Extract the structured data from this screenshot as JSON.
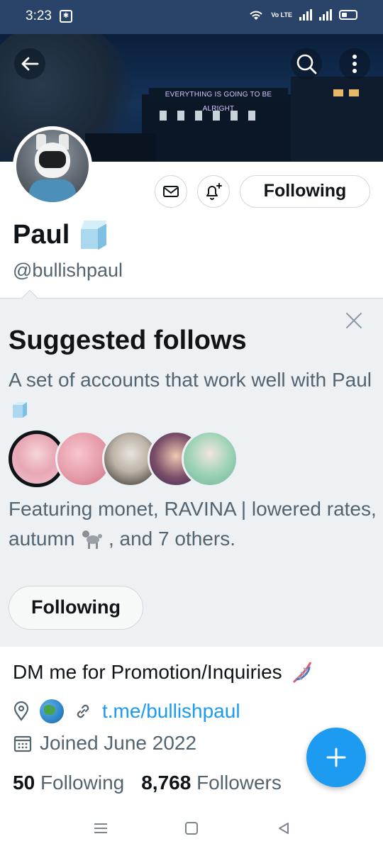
{
  "status_bar": {
    "time": "3:23",
    "network_label": "Vo LTE",
    "colors": {
      "background": "#2a4368"
    }
  },
  "banner": {
    "neon_text": "EVERYTHING IS GOING TO BE ALRIGHT",
    "icons": {
      "back": "arrow-left-icon",
      "search": "search-icon",
      "more": "more-vertical-icon"
    }
  },
  "profile": {
    "display_name": "Paul",
    "name_emoji": "ice-cube",
    "handle": "@bullishpaul",
    "following_button_label": "Following",
    "icons": {
      "message": "envelope-icon",
      "notifications": "bell-plus-icon"
    }
  },
  "suggested_follows": {
    "title": "Suggested follows",
    "description": "A set of accounts that work well with Paul",
    "featuring_text_part1": "Featuring monet, RAVINA | lowered rates, autumn",
    "featuring_text_part2": ", and 7 others.",
    "following_button_label": "Following",
    "avatar_count": 5
  },
  "bio": {
    "text": "DM me for Promotion/Inquiries",
    "link": "t.me/bullishpaul",
    "joined": "Joined June 2022"
  },
  "stats": {
    "following_count": "50",
    "following_label": "Following",
    "followers_count": "8,768",
    "followers_label": "Followers"
  },
  "colors": {
    "accent": "#1d9bf0",
    "text_primary": "#0f1419",
    "text_secondary": "#536471",
    "suggest_background": "#eef1f3"
  }
}
